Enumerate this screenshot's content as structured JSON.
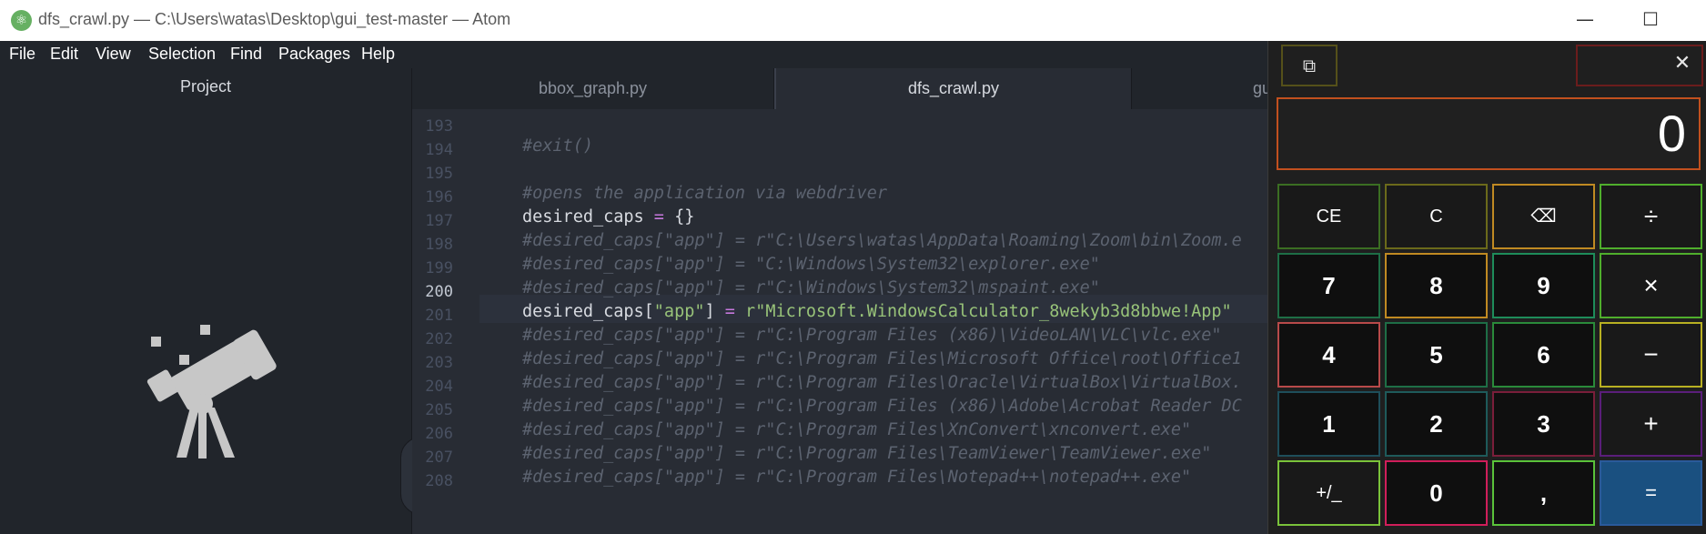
{
  "window": {
    "title": "dfs_crawl.py — C:\\Users\\watas\\Desktop\\gui_test-master — Atom",
    "logo_icon": "atom-logo-icon",
    "minimize_glyph": "—",
    "maximize_glyph": "☐"
  },
  "menu": {
    "items": [
      "File",
      "Edit",
      "View",
      "Selection",
      "Find",
      "Packages",
      "Help"
    ]
  },
  "project": {
    "title": "Project",
    "collapse_glyph": "‹"
  },
  "tabs": [
    {
      "label": "bbox_graph.py",
      "active": false
    },
    {
      "label": "dfs_crawl.py",
      "active": true
    },
    {
      "label": "gu",
      "active": false
    }
  ],
  "editor": {
    "current_line": 200,
    "lines": [
      {
        "num": "193",
        "text": "#exit()",
        "kind": "comment"
      },
      {
        "num": "194",
        "text": "",
        "kind": "blank"
      },
      {
        "num": "195",
        "text": "#opens the application via webdriver",
        "kind": "comment"
      },
      {
        "num": "196",
        "id": "desired_caps",
        "op": " = ",
        "rest": "{}",
        "kind": "assign_dict"
      },
      {
        "num": "197",
        "text": "#desired_caps[\"app\"] = r\"C:\\Users\\watas\\AppData\\Roaming\\Zoom\\bin\\Zoom.e",
        "kind": "comment"
      },
      {
        "num": "198",
        "text": "#desired_caps[\"app\"] = \"C:\\Windows\\System32\\explorer.exe\"",
        "kind": "comment"
      },
      {
        "num": "199",
        "text": "#desired_caps[\"app\"] = r\"C:\\Windows\\System32\\mspaint.exe\"",
        "kind": "comment"
      },
      {
        "num": "200",
        "id": "desired_caps[",
        "str1": "\"app\"",
        "id2": "] ",
        "op": "=",
        "str2": " r\"Microsoft.WindowsCalculator_8wekyb3d8bbwe!App\"",
        "kind": "assign_str"
      },
      {
        "num": "201",
        "text": "#desired_caps[\"app\"] = r\"C:\\Program Files (x86)\\VideoLAN\\VLC\\vlc.exe\"",
        "kind": "comment"
      },
      {
        "num": "202",
        "text": "#desired_caps[\"app\"] = r\"C:\\Program Files\\Microsoft Office\\root\\Office1",
        "kind": "comment"
      },
      {
        "num": "203",
        "text": "#desired_caps[\"app\"] = r\"C:\\Program Files\\Oracle\\VirtualBox\\VirtualBox.",
        "kind": "comment"
      },
      {
        "num": "204",
        "text": "#desired_caps[\"app\"] = r\"C:\\Program Files (x86)\\Adobe\\Acrobat Reader DC",
        "kind": "comment"
      },
      {
        "num": "205",
        "text": "#desired_caps[\"app\"] = r\"C:\\Program Files\\XnConvert\\xnconvert.exe\"",
        "kind": "comment"
      },
      {
        "num": "206",
        "text": "#desired_caps[\"app\"] = r\"C:\\Program Files\\TeamViewer\\TeamViewer.exe\"",
        "kind": "comment"
      },
      {
        "num": "207",
        "text": "#desired_caps[\"app\"] = r\"C:\\Program Files\\Notepad++\\notepad++.exe\"",
        "kind": "comment"
      },
      {
        "num": "208",
        "text": "",
        "kind": "blank"
      }
    ]
  },
  "calculator": {
    "compact_glyph": "⧉",
    "close_glyph": "✕",
    "display_value": "0",
    "keys": [
      {
        "label": "CE",
        "name": "clear-entry-button",
        "kind": "fn",
        "border": "#3b6e22"
      },
      {
        "label": "C",
        "name": "clear-button",
        "kind": "fn",
        "border": "#6b6a1a"
      },
      {
        "label": "⌫",
        "name": "backspace-button",
        "kind": "fn",
        "border": "#c08a22"
      },
      {
        "label": "÷",
        "name": "divide-button",
        "kind": "op",
        "border": "#4fae2c"
      },
      {
        "label": "7",
        "name": "digit-7-button",
        "kind": "num",
        "border": "#1e6e46"
      },
      {
        "label": "8",
        "name": "digit-8-button",
        "kind": "num",
        "border": "#c08a22"
      },
      {
        "label": "9",
        "name": "digit-9-button",
        "kind": "num",
        "border": "#1e8c5a"
      },
      {
        "label": "×",
        "name": "multiply-button",
        "kind": "op",
        "border": "#4fae2c"
      },
      {
        "label": "4",
        "name": "digit-4-button",
        "kind": "num",
        "border": "#b84a4a"
      },
      {
        "label": "5",
        "name": "digit-5-button",
        "kind": "num",
        "border": "#1e6e46"
      },
      {
        "label": "6",
        "name": "digit-6-button",
        "kind": "num",
        "border": "#2a8a3a"
      },
      {
        "label": "−",
        "name": "subtract-button",
        "kind": "op",
        "border": "#b8b022"
      },
      {
        "label": "1",
        "name": "digit-1-button",
        "kind": "num",
        "border": "#1e4e5a"
      },
      {
        "label": "2",
        "name": "digit-2-button",
        "kind": "num",
        "border": "#1e5a5a"
      },
      {
        "label": "3",
        "name": "digit-3-button",
        "kind": "num",
        "border": "#7a1e3a"
      },
      {
        "label": "+",
        "name": "add-button",
        "kind": "op",
        "border": "#5a1e7a"
      },
      {
        "label": "+/_",
        "name": "negate-button",
        "kind": "fn",
        "border": "#7ac23a"
      },
      {
        "label": "0",
        "name": "digit-0-button",
        "kind": "num",
        "border": "#d01e5a"
      },
      {
        "label": ",",
        "name": "decimal-button",
        "kind": "num",
        "border": "#5ac23a"
      },
      {
        "label": "=",
        "name": "equals-button",
        "kind": "eq",
        "border": "#2a5a9a"
      }
    ]
  },
  "colors": {
    "editor_bg": "#282c34",
    "panel_bg": "#21252b",
    "comment": "#5c6370",
    "string": "#98c379",
    "operator": "#c678dd",
    "calc_equals": "#1a5080",
    "calc_display_border": "#c2501e"
  }
}
